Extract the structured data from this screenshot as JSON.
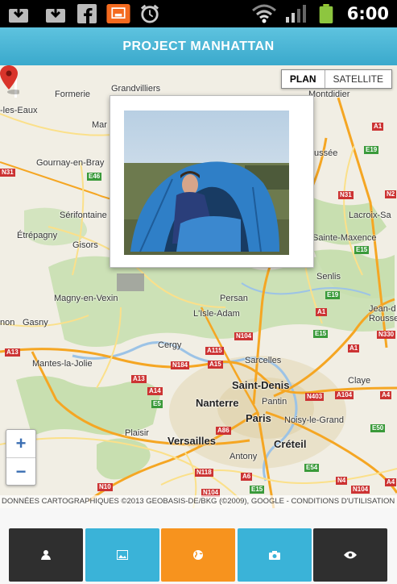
{
  "status_bar": {
    "time": "6:00",
    "icons": [
      "download-icon",
      "download-icon",
      "facebook-icon",
      "screen-icon",
      "alarm-icon",
      "wifi-icon",
      "signal-icon",
      "battery-icon"
    ]
  },
  "title_bar": {
    "title": "PROJECT MANHATTAN"
  },
  "map": {
    "type_control": {
      "plan_label": "PLAN",
      "satellite_label": "SATELLITE",
      "selected": "PLAN"
    },
    "zoom": {
      "in_label": "+",
      "out_label": "−"
    },
    "attribution": "DONNÉES CARTOGRAPHIQUES ©2013 GEOBASIS-DE/BKG (©2009), GOOGLE - CONDITIONS D'UTILISATION",
    "places": {
      "formerie": "Formerie",
      "grandvilliers": "Grandvilliers",
      "montdidier": "Montdidier",
      "les_eaux": "-les-Eaux",
      "mar": "Mar",
      "gournay": "Gournay-en-Bray",
      "serifontaine": "Sérifontaine",
      "etrepagny": "Étrépagny",
      "gisors": "Gisors",
      "usse": "ussée",
      "lacroix": "Lacroix-Sa",
      "sainte_maxence": "Sainte-Maxence",
      "senlis": "Senlis",
      "magny": "Magny-en-Vexin",
      "persan": "Persan",
      "lisle_adam": "L'Isle-Adam",
      "non": "non",
      "gasny": "Gasny",
      "jean_de": "Jean-d",
      "rousse": "Rousse",
      "cergy": "Cergy",
      "sarcelles": "Sarcelles",
      "mantes": "Mantes-la-Jolie",
      "claye": "Claye",
      "saint_denis": "Saint-Denis",
      "nanterre": "Nanterre",
      "pantin": "Pantin",
      "paris": "Paris",
      "noisy": "Noisy-le-Grand",
      "plaisir": "Plaisir",
      "versailles": "Versailles",
      "creteil": "Créteil",
      "antony": "Antony"
    },
    "shields": {
      "n31_left": "N31",
      "e46": "E46",
      "a1_top": "A1",
      "e19_top": "E19",
      "n31_right": "N31",
      "n2": "N2",
      "e15_top": "E15",
      "e19_mid": "E19",
      "a1_mid": "A1",
      "n330": "N330",
      "e15_mid": "E15",
      "n104_top": "N104",
      "a13_left": "A13",
      "a115": "A115",
      "n184": "N184",
      "a15": "A15",
      "a1_low": "A1",
      "a13_mid": "A13",
      "a14": "A14",
      "e5": "E5",
      "n403": "N403",
      "a104": "A104",
      "a4_right": "A4",
      "e50": "E50",
      "a86": "A86",
      "e54": "E54",
      "n118": "N118",
      "a6": "A6",
      "n10": "N10",
      "e15_bottom": "E15",
      "n104_bottom": "N104",
      "n4": "N4",
      "n104_right": "N104",
      "a4_bottom": "A4"
    }
  },
  "tabs": [
    {
      "name": "profile",
      "icon": "person-icon",
      "color": "#2f2f2f"
    },
    {
      "name": "gallery",
      "icon": "image-icon",
      "color": "#3ab3d8"
    },
    {
      "name": "map",
      "icon": "globe-icon",
      "color": "#f7931e",
      "active": true
    },
    {
      "name": "camera",
      "icon": "camera-icon",
      "color": "#3ab3d8"
    },
    {
      "name": "view",
      "icon": "eye-icon",
      "color": "#2f2f2f"
    }
  ],
  "colors": {
    "title_bar": "#4bb6d6",
    "tab_dark": "#2f2f2f",
    "tab_blue": "#3ab3d8",
    "tab_orange": "#f7931e",
    "marker": "#d9342b"
  }
}
